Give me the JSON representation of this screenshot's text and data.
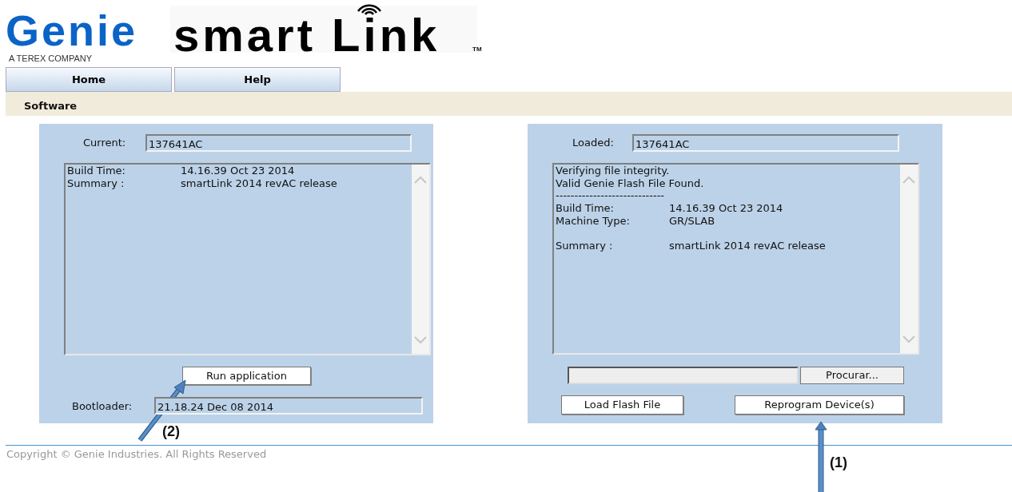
{
  "header": {
    "brand": "Genie",
    "brand_tagline": "A TEREX COMPANY",
    "product": "smart Link",
    "trademark": "TM"
  },
  "nav_tabs": [
    {
      "label": "Home"
    },
    {
      "label": "Help"
    }
  ],
  "section_title": "Software",
  "current_panel": {
    "current_label": "Current:",
    "current_value": "137641AC",
    "info_lines": [
      {
        "kind": "pair",
        "label": "Build Time:",
        "value": "14.16.39 Oct 23 2014"
      },
      {
        "kind": "pair",
        "label": "Summary :",
        "value": "smartLink 2014 revAC release"
      }
    ],
    "run_button": "Run application",
    "bootloader_label": "Bootloader:",
    "bootloader_value": "21.18.24 Dec 08 2014"
  },
  "loaded_panel": {
    "loaded_label": "Loaded:",
    "loaded_value": "137641AC",
    "info_lines": [
      {
        "kind": "text",
        "text": "Verifying file integrity."
      },
      {
        "kind": "text",
        "text": "Valid Genie Flash File Found."
      },
      {
        "kind": "text",
        "text": "-----------------------------"
      },
      {
        "kind": "pair",
        "label": "Build Time:",
        "value": "14.16.39 Oct 23 2014"
      },
      {
        "kind": "pair",
        "label": "Machine Type:",
        "value": "GR/SLAB"
      },
      {
        "kind": "gap"
      },
      {
        "kind": "pair",
        "label": "Summary :",
        "value": "smartLink 2014 revAC release"
      }
    ],
    "browse_button": "Procurar...",
    "load_button": "Load Flash File",
    "reprogram_button": "Reprogram Device(s)"
  },
  "footer": "Copyright © Genie Industries. All Rights Reserved",
  "annotations": [
    {
      "kind": "diagonal",
      "label": "(2)"
    },
    {
      "kind": "vertical",
      "label": "(1)"
    }
  ]
}
